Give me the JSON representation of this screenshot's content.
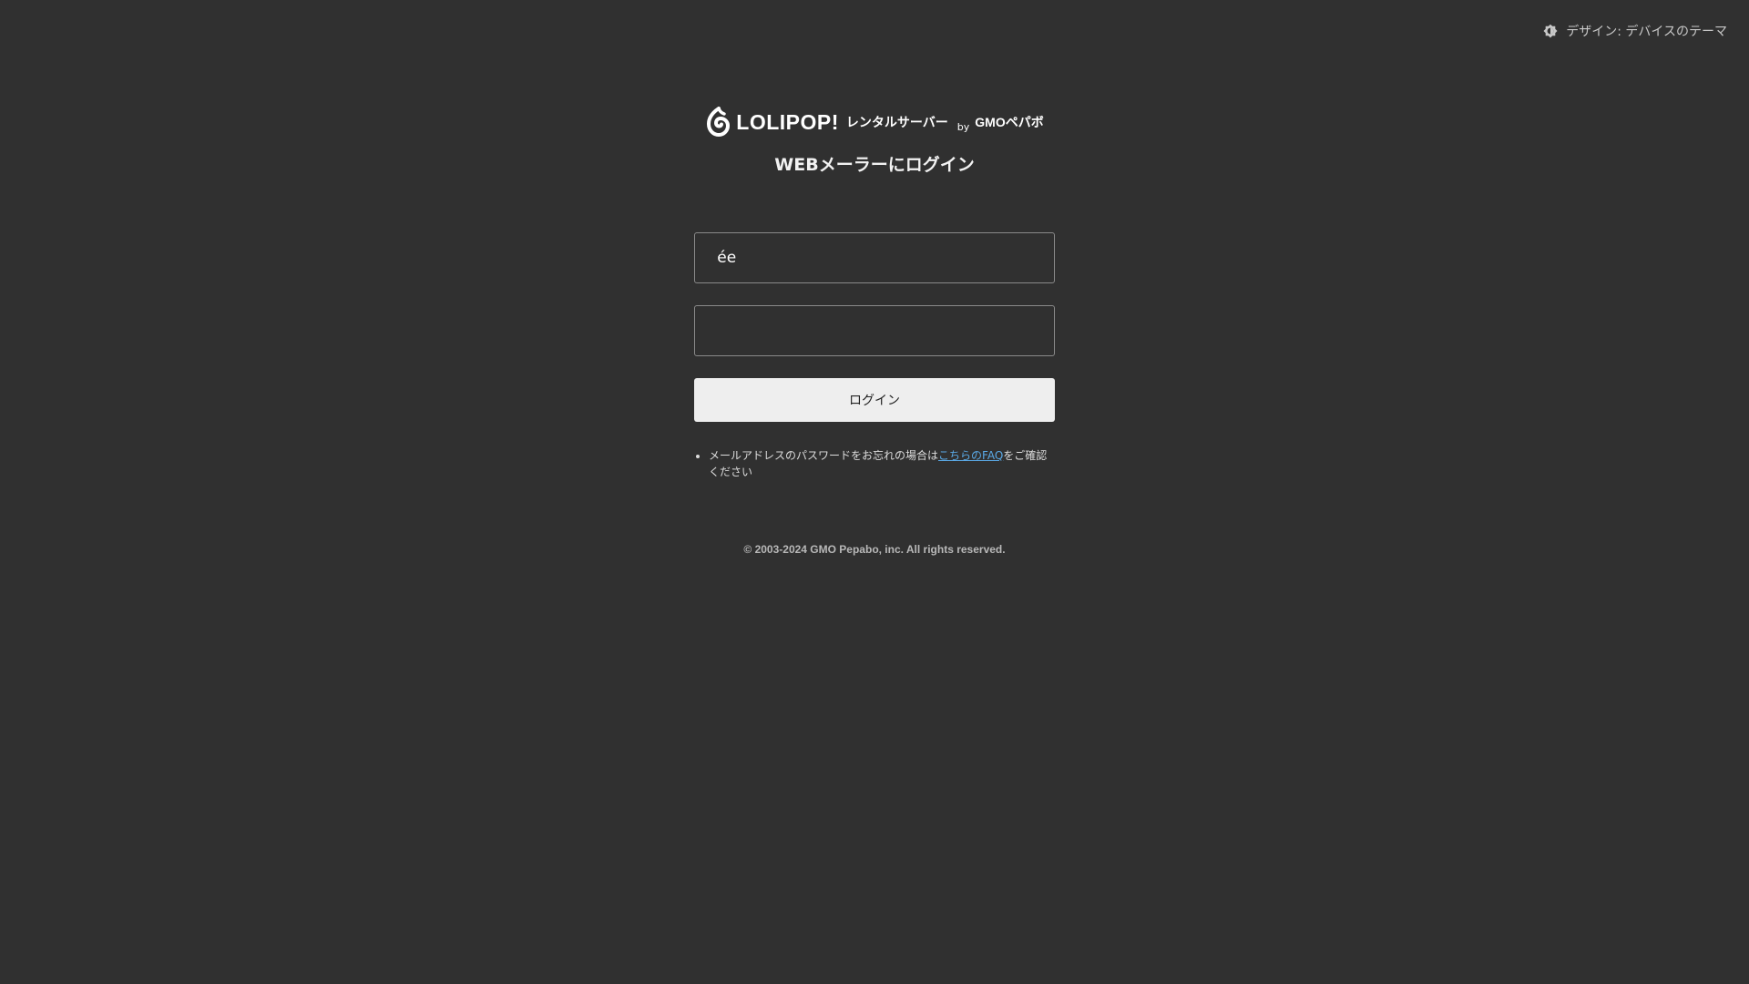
{
  "theme_toggle": {
    "icon": "theme-icon",
    "label": "デザイン: デバイスのテーマ"
  },
  "logo": {
    "wordmark": "LOLIPOP!",
    "subtitle": "レンタルサーバー",
    "by": "by",
    "company": "GMOペパボ"
  },
  "page_title": "WEBメーラーにログイン",
  "form": {
    "email_value": "ée",
    "password_value": "",
    "login_button": "ログイン"
  },
  "notes": {
    "before_link": "メールアドレスのパスワードをお忘れの場合は",
    "link_text": "こちらのFAQ",
    "after_link": "をご確認ください"
  },
  "footer": "© 2003-2024 GMO Pepabo, inc. All rights reserved.",
  "colors": {
    "background": "#303030",
    "button": "#eeeeee",
    "link": "#5aa9e6"
  }
}
